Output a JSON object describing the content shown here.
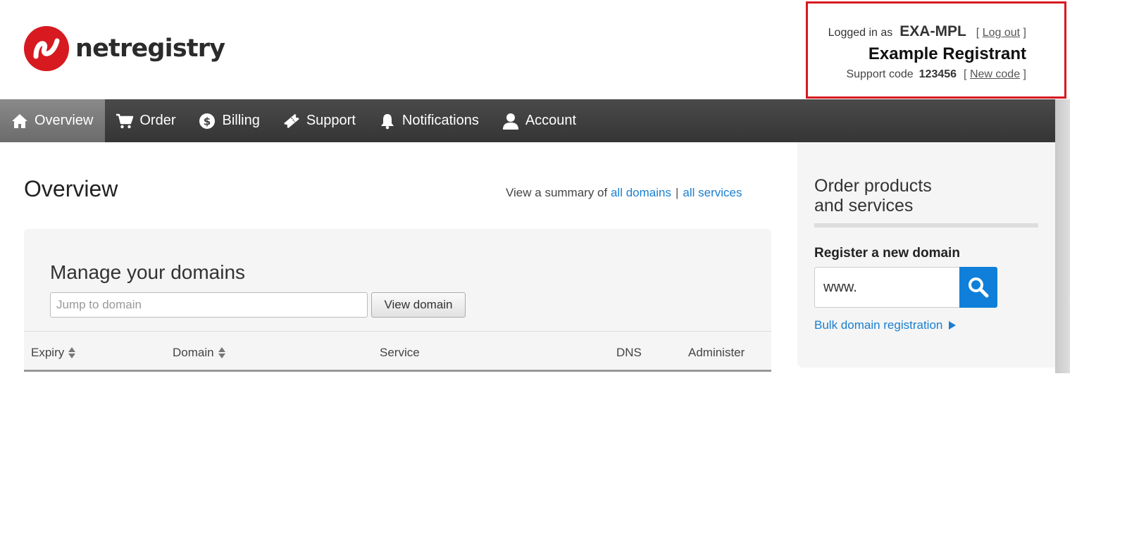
{
  "header": {
    "brand": "netregistry",
    "logged_in_label": "Logged in as",
    "username": "EXA-MPL",
    "logout_label": "Log out",
    "registrant_name": "Example Registrant",
    "support_code_label": "Support code",
    "support_code": "123456",
    "new_code_label": "New code",
    "bracket_open": "[",
    "bracket_close": "]"
  },
  "nav": {
    "items": [
      {
        "label": "Overview",
        "icon": "home-icon",
        "active": true
      },
      {
        "label": "Order",
        "icon": "cart-icon"
      },
      {
        "label": "Billing",
        "icon": "dollar-icon"
      },
      {
        "label": "Support",
        "icon": "ticket-icon"
      },
      {
        "label": "Notifications",
        "icon": "bell-icon"
      },
      {
        "label": "Account",
        "icon": "user-icon"
      }
    ]
  },
  "main": {
    "title": "Overview",
    "summary_prefix": "View a summary of",
    "summary_link1": "all domains",
    "summary_sep": "|",
    "summary_link2": "all services",
    "panel": {
      "title": "Manage your domains",
      "jump_placeholder": "Jump to domain",
      "view_button": "View domain",
      "columns": [
        "Expiry",
        "Domain",
        "Service",
        "DNS",
        "Administer"
      ]
    }
  },
  "sidebar": {
    "title_line1": "Order products",
    "title_line2": "and services",
    "register_label": "Register a new domain",
    "domain_value": "www.",
    "bulk_link": "Bulk domain registration"
  },
  "colors": {
    "brand_red": "#d71920",
    "link_blue": "#1a7fd1",
    "search_button": "#0f7fd9",
    "nav_bg": "#3f3f3f"
  }
}
